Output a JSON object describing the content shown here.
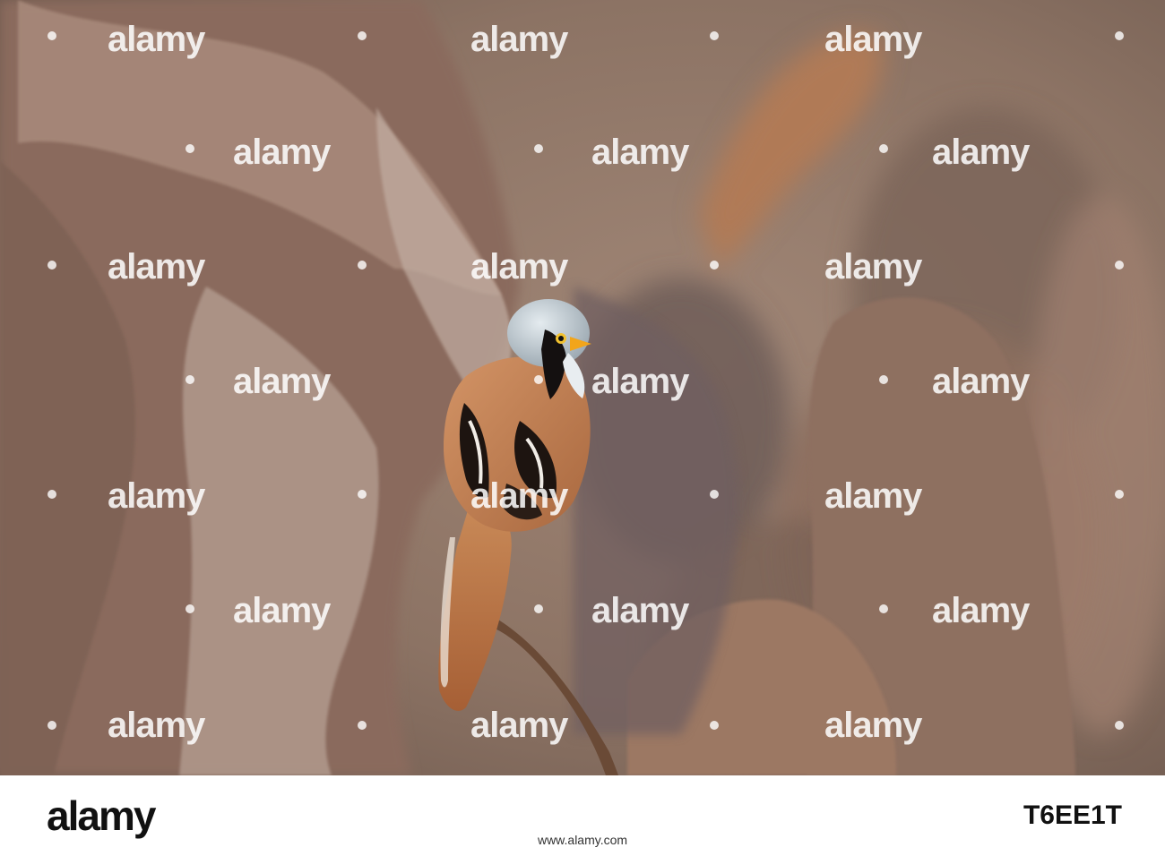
{
  "photo": {
    "subject": "bearded-reedling-icon",
    "colors": {
      "background": "#8f7766",
      "bird_body": "#c07a4c",
      "bird_head": "#b8c4cc",
      "reeds": "#9a7b68",
      "beak": "#f2a51a"
    }
  },
  "watermark": {
    "text": "alamy"
  },
  "footer": {
    "logo": "alamy",
    "image_id": "T6EE1T",
    "url": "www.alamy.com"
  }
}
